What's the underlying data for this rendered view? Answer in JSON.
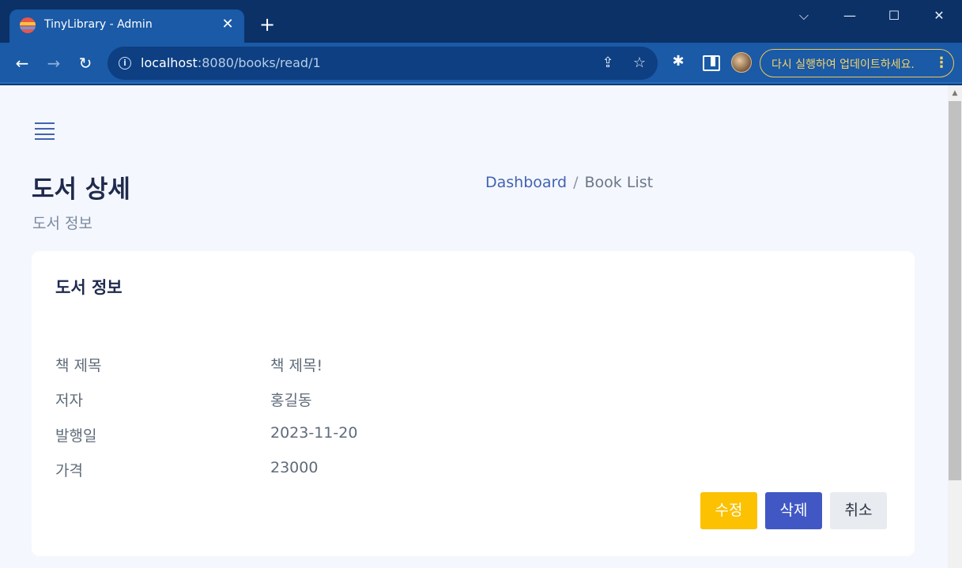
{
  "browser": {
    "tab_title": "TinyLibrary - Admin",
    "tab_close": "✕",
    "new_tab": "+",
    "url_host": "localhost",
    "url_rest": ":8080/books/read/1",
    "update_text": "다시 실행하여 업데이트하세요.",
    "icons": [
      "favicon-icon",
      "close-icon",
      "plus-icon",
      "chevron-down-icon",
      "minimize-icon",
      "maximize-icon",
      "close-window-icon",
      "back-icon",
      "forward-icon",
      "reload-icon",
      "info-icon",
      "share-icon",
      "star-icon",
      "extensions-icon",
      "side-panel-icon",
      "kebab-icon"
    ]
  },
  "page": {
    "title": "도서 상세",
    "subtitle": "도서 정보",
    "breadcrumb": {
      "link": "Dashboard",
      "separator": "/",
      "current": "Book List"
    }
  },
  "card": {
    "title": "도서 정보",
    "fields": [
      {
        "label": "책 제목",
        "value": "책 제목!"
      },
      {
        "label": "저자",
        "value": "홍길동"
      },
      {
        "label": "발행일",
        "value": "2023-11-20"
      },
      {
        "label": "가격",
        "value": "23000"
      }
    ],
    "buttons": {
      "edit": "수정",
      "delete": "삭제",
      "cancel": "취소"
    }
  },
  "colors": {
    "primary": "#4158c4",
    "warning": "#fcc100",
    "secondary": "#e8ebef",
    "title": "#1f2a4d",
    "text": "#5f6b7a",
    "background": "#f4f7fd"
  }
}
